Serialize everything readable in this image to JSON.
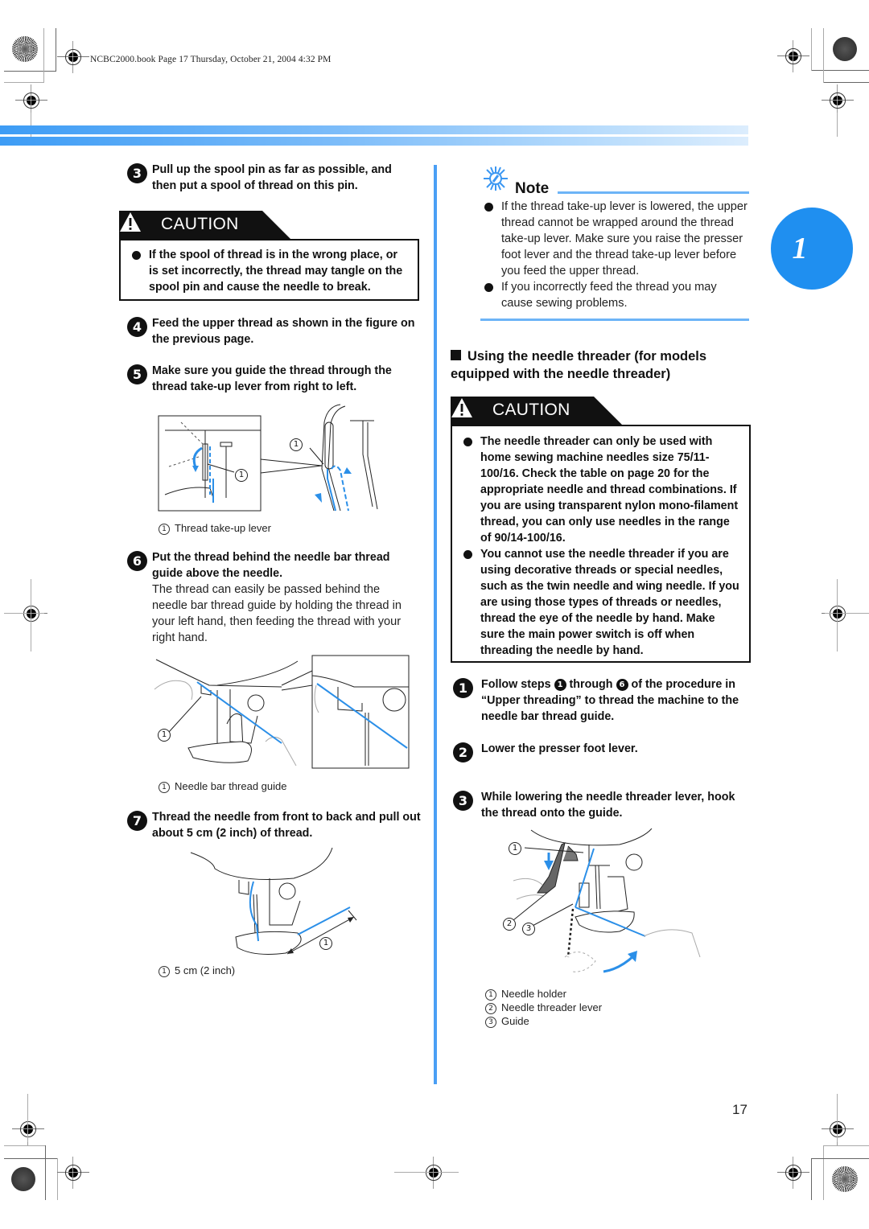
{
  "print_header": "NCBC2000.book  Page 17  Thursday, October 21, 2004  4:32 PM",
  "chapter": {
    "number": "1",
    "color": "#1f8ff0"
  },
  "accent_color": "#4a9ff5",
  "page_number": "17",
  "left_column": {
    "step3": {
      "num": "3",
      "text": "Pull up the spool pin as far as possible, and then put a spool of thread on this pin."
    },
    "caution1": {
      "label": "CAUTION",
      "items": [
        "If the spool of thread is in the wrong place, or is set incorrectly, the thread may tangle on the spool pin and cause the needle to break."
      ]
    },
    "step4": {
      "num": "4",
      "text": "Feed the upper thread as shown in the figure on the previous page."
    },
    "step5": {
      "num": "5",
      "text": "Make sure you guide the thread through the thread take-up lever from right to left."
    },
    "figure1": {
      "callout": "1",
      "caption_num": "1",
      "caption": "Thread take-up lever"
    },
    "step6": {
      "num": "6",
      "text": "Put the thread behind the needle bar thread guide above the needle.",
      "detail": "The thread can easily be passed behind the needle bar thread guide by holding the thread in your left hand, then feeding the thread with your right hand."
    },
    "figure2": {
      "callout": "1",
      "caption_num": "1",
      "caption": "Needle bar thread guide"
    },
    "step7": {
      "num": "7",
      "text": "Thread the needle from front to back and pull out about 5 cm (2 inch) of thread."
    },
    "figure3": {
      "callout": "1",
      "caption_num": "1",
      "caption": "5 cm (2 inch)"
    }
  },
  "right_column": {
    "note": {
      "title": "Note",
      "items": [
        "If the thread take-up lever is lowered, the upper thread cannot be wrapped around the thread take-up lever. Make sure you raise the presser foot lever and the thread take-up lever before you feed the upper thread.",
        "If you incorrectly feed the thread you may cause sewing problems."
      ]
    },
    "section_title": "Using the needle threader (for models equipped with the needle threader)",
    "caution2": {
      "label": "CAUTION",
      "items": [
        "The needle threader can only be used with home sewing machine needles size 75/11-100/16. Check the table on page 20 for the appropriate needle and thread combinations. If you are using transparent nylon mono-filament thread, you can only use needles in the range of 90/14-100/16.",
        "You cannot use the needle threader if you are using decorative threads or special needles, such as the twin needle and wing needle. If you are using those types of threads or needles, thread the eye of the needle by hand. Make sure the main power switch is off when threading the needle by hand."
      ]
    },
    "step1": {
      "num": "1",
      "pre": "Follow steps ",
      "ref_a": "1",
      "mid": " through ",
      "ref_b": "6",
      "post": " of the procedure in “Upper threading” to thread the machine to the needle bar thread guide."
    },
    "step2": {
      "num": "2",
      "text": "Lower the presser foot lever."
    },
    "step3": {
      "num": "3",
      "text": "While lowering the needle threader lever, hook the thread onto the guide."
    },
    "figure4": {
      "callouts": [
        "1",
        "2",
        "3"
      ],
      "legend": [
        {
          "num": "1",
          "label": "Needle holder"
        },
        {
          "num": "2",
          "label": "Needle threader lever"
        },
        {
          "num": "3",
          "label": "Guide"
        }
      ]
    }
  }
}
